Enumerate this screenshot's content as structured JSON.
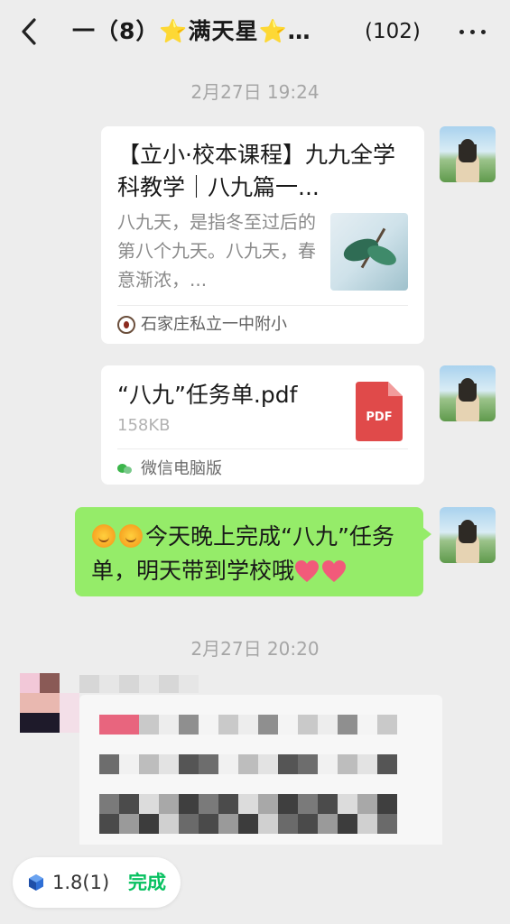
{
  "header": {
    "title": "一（8）⭐满天星⭐…",
    "member_count": "(102)"
  },
  "messages": [
    {
      "type": "timestamp",
      "text": "2月27日 19:24"
    },
    {
      "type": "link_card",
      "title": "【立小·校本课程】九九全学科教学｜八九篇一...",
      "description": "八九天，是指冬至过后的第八个九天。八九天，春意渐浓，...",
      "source": "石家庄私立一中附小"
    },
    {
      "type": "file",
      "file_name": "“八九”任务单.pdf",
      "file_size": "158KB",
      "file_type": "PDF",
      "source": "微信电脑版"
    },
    {
      "type": "text",
      "text_main": "今天晚上完成“八九”任务单，明天带到学校哦"
    },
    {
      "type": "timestamp",
      "text": "2月27日 20:20"
    }
  ],
  "bottom": {
    "version": "1.8(1)",
    "done_label": "完成"
  },
  "colors": {
    "background": "#ededed",
    "bubble_green": "#95ec69",
    "done_green": "#07c160",
    "pdf_red": "#e04a4a"
  }
}
